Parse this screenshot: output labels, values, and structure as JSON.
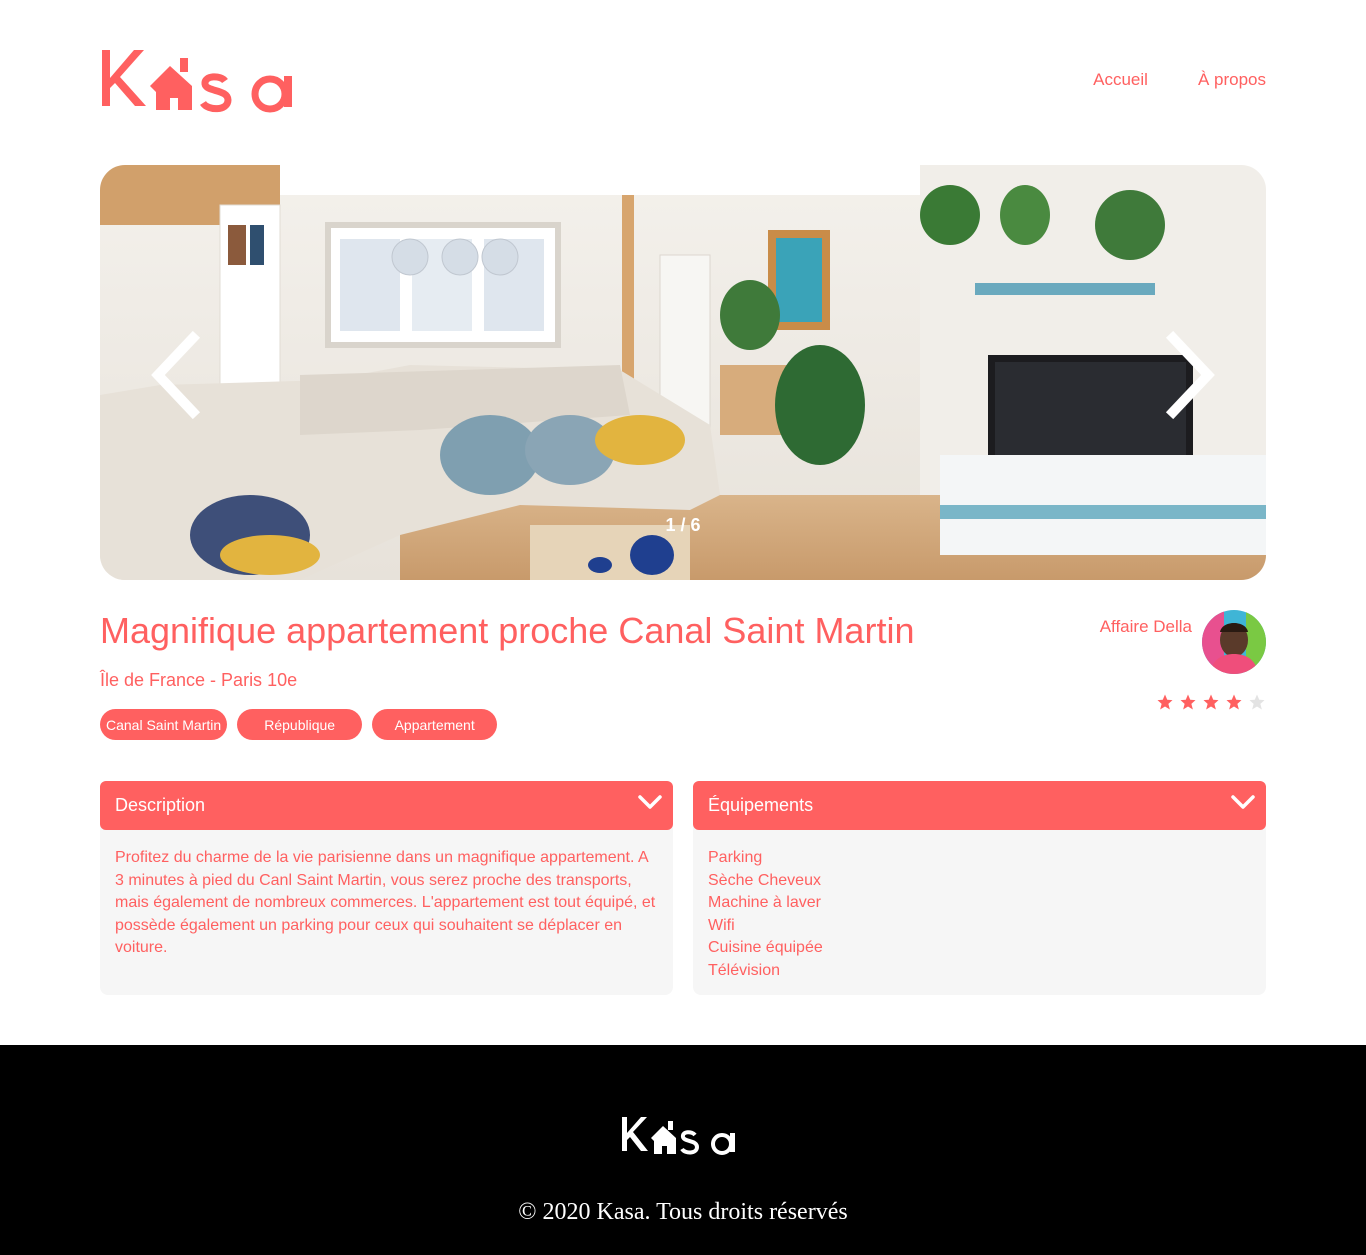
{
  "header": {
    "logo_text": "Kasa",
    "nav": [
      {
        "label": "Accueil"
      },
      {
        "label": "À propos"
      }
    ]
  },
  "gallery": {
    "counter": "1 / 6",
    "current": 1,
    "total": 6
  },
  "listing": {
    "title": "Magnifique appartement proche Canal Saint Martin",
    "location": "Île de France - Paris 10e",
    "tags": [
      "Canal Saint Martin",
      "République",
      "Appartement"
    ],
    "host": {
      "name": "Affaire Della"
    },
    "rating": 4,
    "rating_max": 5
  },
  "collapses": {
    "description": {
      "title": "Description",
      "text": "Profitez du charme de la vie parisienne dans un magnifique appartement. A 3 minutes à pied du Canl Saint Martin, vous serez proche des transports, mais également de nombreux commerces. L'appartement est tout équipé, et possède également un parking pour ceux qui souhaitent se déplacer en voiture."
    },
    "equipment": {
      "title": "Équipements",
      "items": [
        "Parking",
        "Sèche Cheveux",
        "Machine à laver",
        "Wifi",
        "Cuisine équipée",
        "Télévision"
      ]
    }
  },
  "footer": {
    "logo_text": "Kasa",
    "copyright": "© 2020 Kasa. Tous droits réservés"
  },
  "colors": {
    "primary": "#FF6060",
    "background_light": "#F6F6F6",
    "footer_bg": "#000000",
    "star_inactive": "#E3E3E3"
  },
  "icons": [
    "house-icon",
    "chevron-left-icon",
    "chevron-right-icon",
    "chevron-down-icon",
    "star-icon"
  ]
}
